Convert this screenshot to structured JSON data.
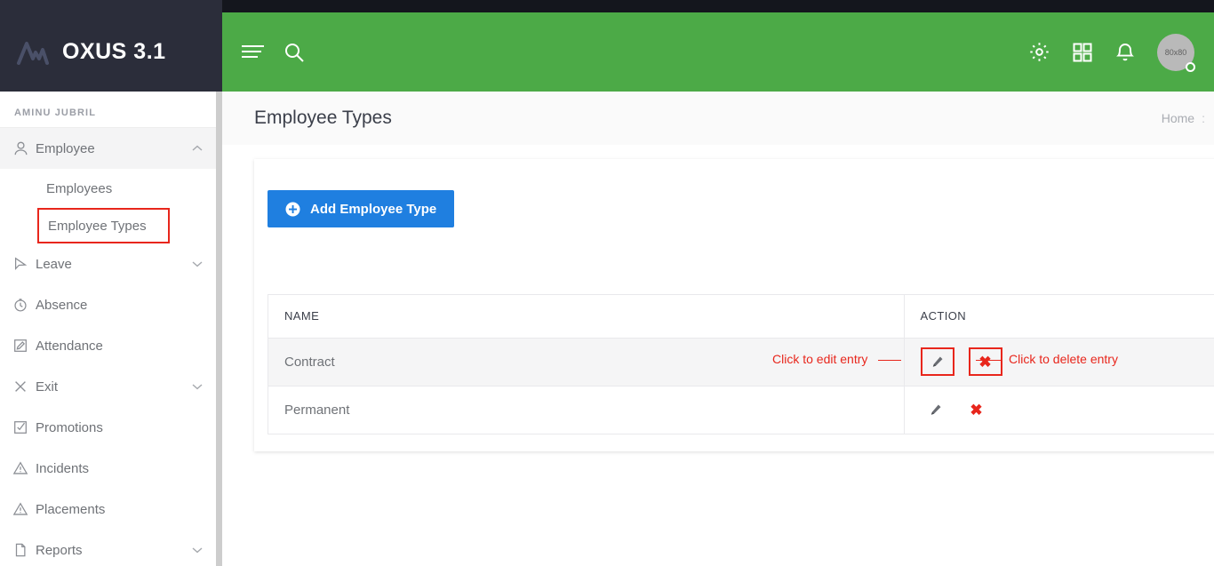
{
  "brand": {
    "name": "OXUS 3.1",
    "logo_icon": "oxus-wave-logo-icon"
  },
  "sidebar": {
    "user_label": "AMINU JUBRIL",
    "items": [
      {
        "label": "Employee",
        "icon": "user-icon",
        "caret": "chevron-up-icon",
        "active": true,
        "sub": true
      },
      {
        "label": "Employees",
        "icon": "",
        "caret": "",
        "active": false,
        "sub": true
      },
      {
        "label": "Employee Types",
        "icon": "",
        "caret": "",
        "active": false,
        "sub": true,
        "highlighted": true
      },
      {
        "label": "Leave",
        "icon": "cursor-icon",
        "caret": "chevron-down-icon",
        "active": false
      },
      {
        "label": "Absence",
        "icon": "clock-icon",
        "caret": "",
        "active": false
      },
      {
        "label": "Attendance",
        "icon": "edit-square-icon",
        "caret": "",
        "active": false
      },
      {
        "label": "Exit",
        "icon": "close-x-icon",
        "caret": "chevron-down-icon",
        "active": false
      },
      {
        "label": "Promotions",
        "icon": "check-square-icon",
        "caret": "",
        "active": false
      },
      {
        "label": "Incidents",
        "icon": "alert-triangle-icon",
        "caret": "",
        "active": false
      },
      {
        "label": "Placements",
        "icon": "alert-triangle-icon",
        "caret": "",
        "active": false
      },
      {
        "label": "Reports",
        "icon": "file-icon",
        "caret": "chevron-down-icon",
        "active": false
      }
    ]
  },
  "header": {
    "menu_icon": "hamburger-lines-icon",
    "search_icon": "search-icon",
    "settings_icon": "gear-icon",
    "apps_icon": "grid-apps-icon",
    "notifications_icon": "bell-icon",
    "avatar_label": "80x80",
    "accent_color": "#4caa47"
  },
  "page": {
    "title": "Employee Types",
    "breadcrumb": {
      "home": "Home",
      "separator": ":"
    }
  },
  "card": {
    "add_button": {
      "label": "Add Employee Type",
      "icon": "plus-circle-icon",
      "color": "#1f7fe0"
    }
  },
  "table": {
    "columns": [
      "NAME",
      "ACTION"
    ],
    "rows": [
      {
        "name": "Contract",
        "edit_icon": "pencil-icon",
        "delete_icon": "x-icon",
        "hovered": true
      },
      {
        "name": "Permanent",
        "edit_icon": "pencil-icon",
        "delete_icon": "x-icon",
        "hovered": false
      }
    ]
  },
  "annotations": {
    "edit": "Click to edit entry",
    "delete": "Click to delete entry",
    "color": "#e8261c"
  }
}
